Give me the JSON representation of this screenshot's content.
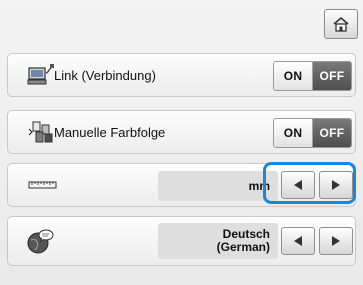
{
  "header": {
    "home_button": {
      "icon": "home-icon"
    }
  },
  "settings": [
    {
      "icon": "pc-link-icon",
      "label": "Link (Verbindung)",
      "toggle": {
        "on_label": "ON",
        "off_label": "OFF",
        "state": "OFF"
      }
    },
    {
      "icon": "color-sequence-icon",
      "label": "Manuelle Farbfolge",
      "toggle": {
        "on_label": "ON",
        "off_label": "OFF",
        "state": "OFF"
      }
    },
    {
      "icon": "ruler-icon",
      "value": "mm",
      "highlighted": true
    },
    {
      "icon": "language-globe-icon",
      "value_line1": "Deutsch",
      "value_line2": "(German)"
    }
  ],
  "colors": {
    "highlight": "#1a86d8",
    "off_active": "#4e4e4e"
  }
}
